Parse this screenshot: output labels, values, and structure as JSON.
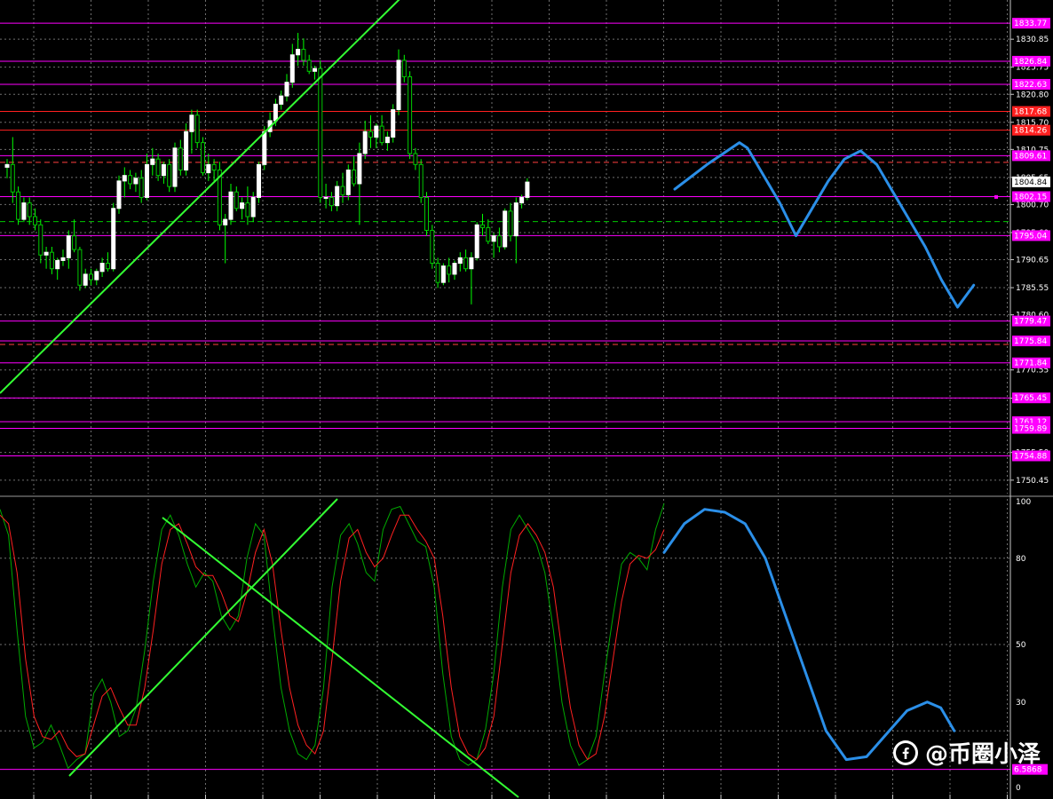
{
  "chart_data": [
    {
      "type": "candlestick",
      "panel": "price",
      "ylim": [
        1748.0,
        1838.0
      ],
      "y_ticks": [
        "1830.85",
        "1825.75",
        "1820.80",
        "1815.70",
        "1810.75",
        "1805.65",
        "1800.70",
        "1795.60",
        "1790.65",
        "1785.55",
        "1780.60",
        "1770.55",
        "1765.40",
        "1755.50",
        "1750.45"
      ],
      "current_price": "1804.84",
      "colors": {
        "bull": "#ffffff",
        "bear": "#00c800",
        "wick": "#00ff00"
      },
      "horizontal_levels": [
        {
          "value": 1833.77,
          "label": "1833.77",
          "color": "#ff00ff"
        },
        {
          "value": 1826.84,
          "label": "1826.84",
          "color": "#ff00ff"
        },
        {
          "value": 1822.63,
          "label": "1822.63",
          "color": "#ff00ff"
        },
        {
          "value": 1817.68,
          "label": "1817.68",
          "color": "#ff2020"
        },
        {
          "value": 1814.26,
          "label": "1814.26",
          "color": "#ff2020"
        },
        {
          "value": 1809.61,
          "label": "1809.61",
          "color": "#ff00ff"
        },
        {
          "value": 1802.15,
          "label": "1802.15",
          "color": "#ff00ff"
        },
        {
          "value": 1795.04,
          "label": "1795.04",
          "color": "#ff00ff"
        },
        {
          "value": 1779.47,
          "label": "1779.47",
          "color": "#ff00ff"
        },
        {
          "value": 1775.84,
          "label": "1775.84",
          "color": "#ff00ff"
        },
        {
          "value": 1771.84,
          "label": "1771.84",
          "color": "#ff00ff"
        },
        {
          "value": 1765.45,
          "label": "1765.45",
          "color": "#ff00ff"
        },
        {
          "value": 1761.12,
          "label": "1761.12",
          "color": "#ff00ff"
        },
        {
          "value": 1759.89,
          "label": "1759.89",
          "color": "#ff00ff"
        },
        {
          "value": 1754.88,
          "label": "1754.88",
          "color": "#ff00ff"
        }
      ],
      "dashed_levels": [
        {
          "value": 1808.4,
          "color": "#ff4040"
        },
        {
          "value": 1797.6,
          "color": "#00c800"
        },
        {
          "value": 1775.2,
          "color": "#ff4040"
        }
      ],
      "candles": [
        [
          1807.5,
          1809.0,
          1805.5,
          1808.0
        ],
        [
          1808.0,
          1813.0,
          1801.0,
          1803.0
        ],
        [
          1803.0,
          1804.0,
          1797.0,
          1798.0
        ],
        [
          1798.0,
          1802.0,
          1797.5,
          1801.0
        ],
        [
          1801.0,
          1802.0,
          1797.0,
          1798.5
        ],
        [
          1798.5,
          1800.0,
          1796.0,
          1797.0
        ],
        [
          1797.0,
          1798.0,
          1790.0,
          1791.5
        ],
        [
          1791.5,
          1793.0,
          1789.0,
          1792.0
        ],
        [
          1792.0,
          1793.0,
          1788.0,
          1789.0
        ],
        [
          1789.0,
          1791.0,
          1787.0,
          1790.5
        ],
        [
          1790.5,
          1792.5,
          1789.5,
          1791.0
        ],
        [
          1791.0,
          1796.0,
          1789.0,
          1795.0
        ],
        [
          1795.0,
          1798.0,
          1792.0,
          1792.5
        ],
        [
          1792.5,
          1793.0,
          1785.0,
          1786.0
        ],
        [
          1786.0,
          1789.0,
          1785.5,
          1788.0
        ],
        [
          1788.0,
          1789.0,
          1786.0,
          1787.0
        ],
        [
          1787.0,
          1789.0,
          1786.0,
          1788.5
        ],
        [
          1788.5,
          1791.0,
          1787.5,
          1790.0
        ],
        [
          1790.0,
          1792.0,
          1788.5,
          1789.0
        ],
        [
          1789.0,
          1801.0,
          1788.5,
          1800.0
        ],
        [
          1800.0,
          1806.0,
          1799.0,
          1805.0
        ],
        [
          1805.0,
          1807.5,
          1802.0,
          1806.0
        ],
        [
          1806.0,
          1807.0,
          1803.5,
          1804.5
        ],
        [
          1804.5,
          1806.5,
          1803.0,
          1805.5
        ],
        [
          1805.5,
          1807.0,
          1801.0,
          1802.0
        ],
        [
          1802.0,
          1810.0,
          1801.5,
          1808.0
        ],
        [
          1808.0,
          1811.0,
          1806.0,
          1809.0
        ],
        [
          1809.0,
          1810.0,
          1805.0,
          1806.0
        ],
        [
          1806.0,
          1808.5,
          1804.5,
          1808.0
        ],
        [
          1808.0,
          1809.0,
          1803.0,
          1804.0
        ],
        [
          1804.0,
          1812.0,
          1803.0,
          1811.0
        ],
        [
          1811.0,
          1812.5,
          1806.0,
          1807.0
        ],
        [
          1807.0,
          1815.5,
          1806.0,
          1814.0
        ],
        [
          1814.0,
          1818.0,
          1810.0,
          1817.0
        ],
        [
          1817.0,
          1818.0,
          1811.0,
          1812.0
        ],
        [
          1812.0,
          1813.0,
          1806.0,
          1806.5
        ],
        [
          1806.5,
          1810.0,
          1805.0,
          1808.0
        ],
        [
          1808.0,
          1809.0,
          1805.0,
          1807.0
        ],
        [
          1807.0,
          1808.5,
          1796.0,
          1797.0
        ],
        [
          1797.0,
          1799.0,
          1790.0,
          1798.0
        ],
        [
          1798.0,
          1804.5,
          1797.0,
          1803.0
        ],
        [
          1803.0,
          1804.0,
          1799.5,
          1800.0
        ],
        [
          1800.0,
          1802.0,
          1798.0,
          1801.0
        ],
        [
          1801.0,
          1804.0,
          1797.0,
          1798.5
        ],
        [
          1798.5,
          1803.0,
          1797.5,
          1802.0
        ],
        [
          1802.0,
          1808.5,
          1801.0,
          1808.0
        ],
        [
          1808.0,
          1815.0,
          1807.0,
          1814.0
        ],
        [
          1814.0,
          1817.5,
          1813.0,
          1816.0
        ],
        [
          1816.0,
          1820.0,
          1815.0,
          1819.0
        ],
        [
          1819.0,
          1821.5,
          1818.0,
          1820.5
        ],
        [
          1820.5,
          1824.5,
          1819.5,
          1823.0
        ],
        [
          1823.0,
          1830.0,
          1822.0,
          1828.0
        ],
        [
          1828.0,
          1832.0,
          1826.0,
          1829.0
        ],
        [
          1829.0,
          1831.0,
          1826.0,
          1827.0
        ],
        [
          1827.0,
          1828.0,
          1824.5,
          1825.0
        ],
        [
          1825.0,
          1826.0,
          1823.5,
          1825.5
        ],
        [
          1825.5,
          1827.0,
          1801.0,
          1802.0
        ],
        [
          1802.0,
          1804.5,
          1800.0,
          1802.0
        ],
        [
          1802.0,
          1803.0,
          1799.5,
          1800.5
        ],
        [
          1800.5,
          1805.0,
          1799.5,
          1804.0
        ],
        [
          1804.0,
          1806.5,
          1801.0,
          1802.5
        ],
        [
          1802.5,
          1808.0,
          1801.5,
          1807.0
        ],
        [
          1807.0,
          1809.5,
          1804.0,
          1804.5
        ],
        [
          1804.5,
          1812.0,
          1797.0,
          1810.0
        ],
        [
          1810.0,
          1816.0,
          1809.0,
          1814.0
        ],
        [
          1814.0,
          1817.0,
          1811.0,
          1813.0
        ],
        [
          1813.0,
          1815.5,
          1811.0,
          1815.0
        ],
        [
          1815.0,
          1817.0,
          1811.5,
          1812.0
        ],
        [
          1812.0,
          1814.0,
          1810.5,
          1813.0
        ],
        [
          1813.0,
          1819.0,
          1812.0,
          1818.0
        ],
        [
          1818.0,
          1829.0,
          1817.0,
          1827.0
        ],
        [
          1827.0,
          1828.0,
          1823.0,
          1824.0
        ],
        [
          1824.0,
          1825.0,
          1809.0,
          1810.0
        ],
        [
          1810.0,
          1811.0,
          1807.0,
          1808.0
        ],
        [
          1808.0,
          1809.0,
          1801.0,
          1802.0
        ],
        [
          1802.0,
          1803.0,
          1795.0,
          1796.0
        ],
        [
          1796.0,
          1797.0,
          1789.0,
          1790.0
        ],
        [
          1790.0,
          1791.0,
          1785.5,
          1786.5
        ],
        [
          1786.5,
          1790.0,
          1786.0,
          1789.5
        ],
        [
          1789.5,
          1791.0,
          1786.5,
          1788.0
        ],
        [
          1788.0,
          1790.5,
          1787.0,
          1790.0
        ],
        [
          1790.0,
          1792.0,
          1788.5,
          1791.0
        ],
        [
          1791.0,
          1792.5,
          1788.5,
          1789.0
        ],
        [
          1789.0,
          1792.0,
          1782.5,
          1791.0
        ],
        [
          1791.0,
          1797.5,
          1790.5,
          1797.0
        ],
        [
          1797.0,
          1799.0,
          1795.0,
          1796.5
        ],
        [
          1796.5,
          1798.0,
          1793.5,
          1794.0
        ],
        [
          1794.0,
          1795.5,
          1791.0,
          1795.0
        ],
        [
          1795.0,
          1796.5,
          1792.0,
          1793.0
        ],
        [
          1793.0,
          1800.0,
          1792.5,
          1799.5
        ],
        [
          1799.5,
          1801.0,
          1794.0,
          1795.0
        ],
        [
          1795.0,
          1802.0,
          1790.0,
          1801.0
        ],
        [
          1801.0,
          1802.5,
          1800.0,
          1802.0
        ],
        [
          1802.0,
          1805.5,
          1801.5,
          1804.8
        ]
      ],
      "trendlines": [
        {
          "color": "#33ff33",
          "from": [
            0,
            1766.3
          ],
          "to": [
            72,
            1840.0
          ],
          "x_unit": "bar_index"
        }
      ],
      "forecast_path": {
        "color": "#2b8fe8",
        "points": [
          [
            1803.5,
            0
          ],
          [
            1808.0,
            4
          ],
          [
            1812.0,
            8
          ],
          [
            1811.0,
            9
          ],
          [
            1806.0,
            11
          ],
          [
            1801.0,
            13
          ],
          [
            1795.0,
            15
          ],
          [
            1800.0,
            17
          ],
          [
            1805.0,
            19
          ],
          [
            1809.0,
            21
          ],
          [
            1810.5,
            23
          ],
          [
            1808.0,
            25
          ],
          [
            1803.0,
            27
          ],
          [
            1798.0,
            29
          ],
          [
            1793.0,
            31
          ],
          [
            1787.0,
            33
          ],
          [
            1782.0,
            35
          ],
          [
            1784.0,
            36
          ],
          [
            1786.0,
            37
          ]
        ],
        "note_order": "value,step"
      }
    },
    {
      "type": "line",
      "panel": "stochastic",
      "ylim": [
        0,
        100
      ],
      "y_ticks": [
        "100",
        "80",
        "50",
        "30",
        "0"
      ],
      "levels": [
        {
          "value": 6.5868,
          "label": "6.5868",
          "color": "#ff00ff"
        }
      ],
      "series": [
        {
          "color": "#00aa00",
          "values": [
            97,
            88,
            55,
            25,
            14,
            16,
            22,
            15,
            7,
            10,
            12,
            33,
            38,
            30,
            18,
            20,
            28,
            48,
            72,
            90,
            95,
            88,
            78,
            70,
            75,
            72,
            60,
            55,
            60,
            80,
            92,
            88,
            60,
            35,
            20,
            12,
            10,
            15,
            35,
            70,
            88,
            92,
            85,
            75,
            72,
            90,
            97,
            98,
            92,
            86,
            84,
            70,
            40,
            18,
            10,
            8,
            10,
            20,
            40,
            70,
            90,
            95,
            90,
            85,
            75,
            55,
            30,
            15,
            8,
            10,
            18,
            40,
            60,
            78,
            82,
            80,
            76,
            90,
            99
          ]
        },
        {
          "color": "#ff2020",
          "values": [
            95,
            92,
            75,
            45,
            25,
            18,
            17,
            20,
            14,
            11,
            12,
            22,
            32,
            35,
            28,
            22,
            22,
            35,
            55,
            78,
            90,
            92,
            85,
            77,
            74,
            74,
            68,
            60,
            58,
            68,
            82,
            90,
            78,
            55,
            35,
            22,
            15,
            12,
            20,
            45,
            72,
            87,
            90,
            82,
            77,
            80,
            88,
            95,
            95,
            90,
            86,
            80,
            60,
            35,
            18,
            12,
            10,
            14,
            25,
            50,
            75,
            88,
            92,
            88,
            82,
            70,
            48,
            28,
            15,
            10,
            12,
            25,
            45,
            65,
            78,
            81,
            80,
            83,
            90
          ]
        }
      ],
      "trendlines": [
        {
          "color": "#33ff33",
          "from": [
            0,
            8.0
          ],
          "to": [
            1,
            100.0
          ],
          "x_unit": "relative"
        },
        {
          "color": "#33ff33",
          "from": [
            0,
            95.0
          ],
          "to": [
            1,
            2.0
          ],
          "x_unit": "relative"
        }
      ],
      "forecast_path": {
        "color": "#2b8fe8",
        "points": [
          [
            82,
            0
          ],
          [
            92,
            3
          ],
          [
            97,
            6
          ],
          [
            96,
            9
          ],
          [
            92,
            12
          ],
          [
            80,
            15
          ],
          [
            60,
            18
          ],
          [
            40,
            21
          ],
          [
            20,
            24
          ],
          [
            10,
            27
          ],
          [
            11,
            30
          ],
          [
            19,
            33
          ],
          [
            27,
            36
          ],
          [
            30,
            39
          ],
          [
            28,
            41
          ],
          [
            20,
            43
          ]
        ],
        "note_order": "value,step"
      }
    }
  ],
  "watermark": {
    "text": "@币圈小泽",
    "icon": "facebook-icon"
  }
}
